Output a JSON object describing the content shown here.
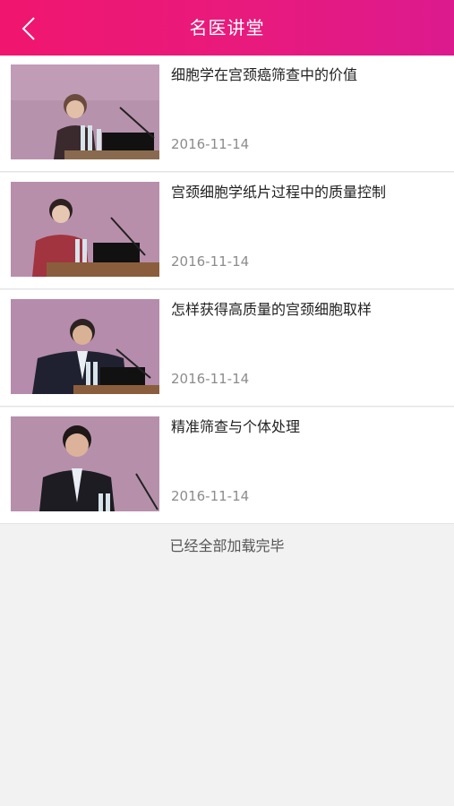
{
  "nav": {
    "title": "名医讲堂",
    "back_icon": "chevron-left-icon"
  },
  "lectures": [
    {
      "title": "细胞学在宫颈癌筛查中的价值",
      "date": "2016-11-14"
    },
    {
      "title": "宫颈细胞学纸片过程中的质量控制",
      "date": "2016-11-14"
    },
    {
      "title": "怎样获得高质量的宫颈细胞取样",
      "date": "2016-11-14"
    },
    {
      "title": "精准筛查与个体处理",
      "date": "2016-11-14"
    }
  ],
  "footer": {
    "text": "已经全部加载完毕"
  },
  "colors": {
    "accent_start": "#f0166f",
    "accent_end": "#dc1a8e",
    "background": "#f2f2f2",
    "thumbnail_bg": "#b98fab"
  }
}
